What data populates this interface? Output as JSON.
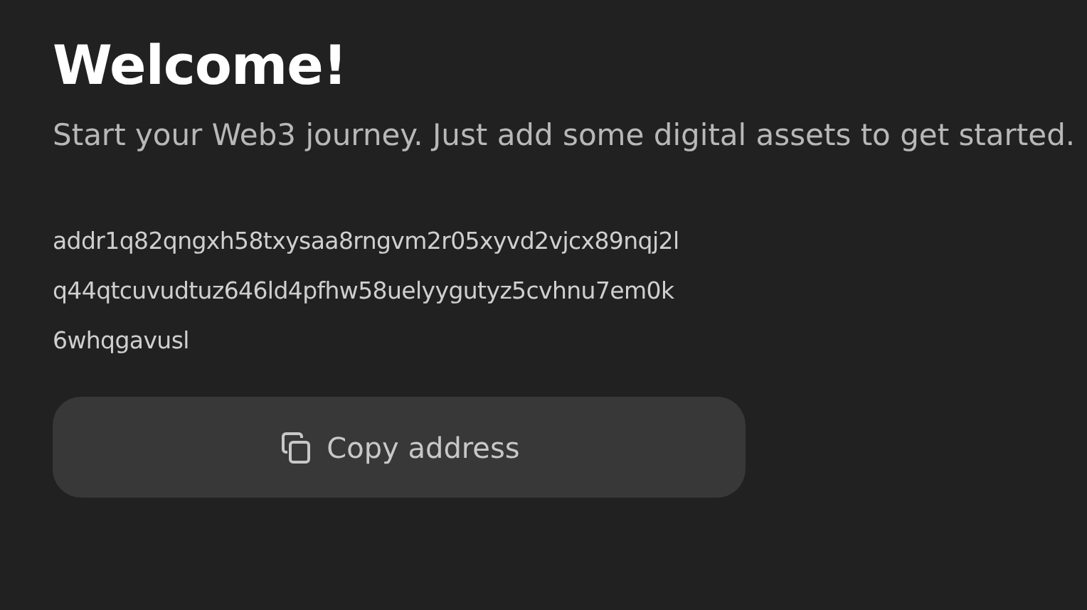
{
  "title": "Welcome!",
  "subtitle": "Start your Web3 journey. Just add some digital assets to get started.",
  "address_lines": [
    "addr1q82qngxh58txysaa8rngvm2r05xyvd2vjcx89nqj2l",
    "q44qtcuvudtuz646ld4pfhw58uelyygutyz5cvhnu7em0k",
    "6whqgavusl"
  ],
  "copy_button": {
    "label": "Copy address"
  }
}
